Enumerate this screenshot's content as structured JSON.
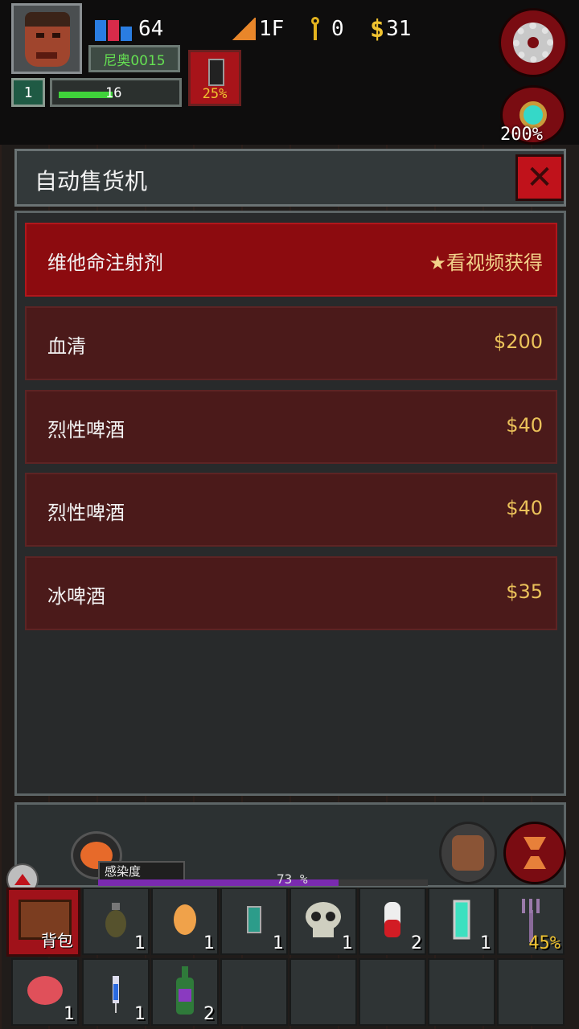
{
  "hud": {
    "survivors": "64",
    "floor": "1F",
    "keys": "0",
    "money": "31",
    "player_name": "尼奥0015",
    "level": "1",
    "xp_value": "16",
    "xp_fraction": 0.45,
    "battery_pct": "25%",
    "zoom": "200%"
  },
  "dialog": {
    "title": "自动售货机",
    "items": [
      {
        "name": "维他命注射剂",
        "price": "★看视频获得",
        "selected": true
      },
      {
        "name": "血清",
        "price": "$200",
        "selected": false
      },
      {
        "name": "烈性啤酒",
        "price": "$40",
        "selected": false
      },
      {
        "name": "烈性啤酒",
        "price": "$40",
        "selected": false
      },
      {
        "name": "冰啤酒",
        "price": "$35",
        "selected": false
      }
    ]
  },
  "status": {
    "infection_label": "感染度",
    "infection_pct": "73 %",
    "infection_fraction": 0.73
  },
  "inventory": {
    "backpack_label": "背包",
    "slots": [
      {
        "icon": "grenade-icon",
        "count": "1"
      },
      {
        "icon": "egg-icon",
        "count": "1"
      },
      {
        "icon": "vial-icon",
        "count": "1"
      },
      {
        "icon": "skull-icon",
        "count": "1"
      },
      {
        "icon": "pill-icon",
        "count": "2"
      },
      {
        "icon": "glowstick-icon",
        "count": "1"
      },
      {
        "icon": "pitchfork-icon",
        "count": "45%"
      },
      {
        "icon": "brain-icon",
        "count": "1"
      },
      {
        "icon": "syringe-icon",
        "count": "1"
      },
      {
        "icon": "bottle-icon",
        "count": "2"
      },
      {
        "icon": "",
        "count": ""
      },
      {
        "icon": "",
        "count": ""
      },
      {
        "icon": "",
        "count": ""
      },
      {
        "icon": "",
        "count": ""
      },
      {
        "icon": "",
        "count": ""
      }
    ]
  },
  "colors": {
    "selected_row": "#8c0b0f",
    "row": "#4b1a1a",
    "price": "#ebc25a",
    "close": "#c0121b"
  }
}
